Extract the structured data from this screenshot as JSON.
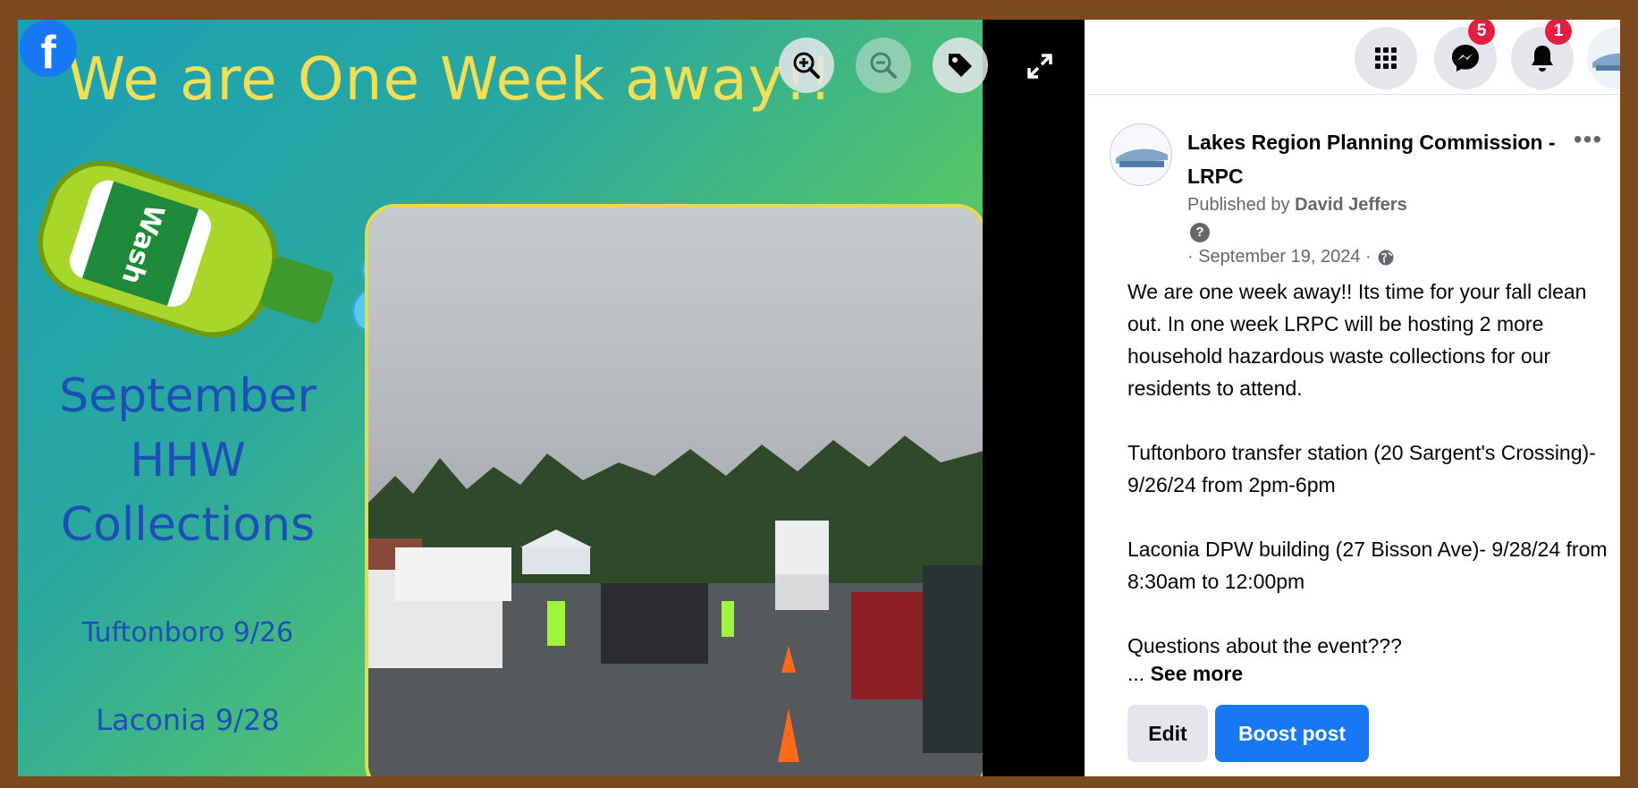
{
  "poster": {
    "title": "We are One Week away!!",
    "bottle_label": "Wash",
    "heading_lines": [
      "September",
      "HHW",
      "Collections"
    ],
    "event1": "Tuftonboro 9/26",
    "event2": "Laconia 9/28"
  },
  "viewer": {
    "brand_icon": "facebook-icon",
    "controls": [
      "zoom-in-icon",
      "zoom-out-icon",
      "tag-icon",
      "expand-icon"
    ]
  },
  "topbar": {
    "menu_icon": "grid-menu-icon",
    "messenger_badge": "5",
    "notifications_badge": "1"
  },
  "post": {
    "page_name": "Lakes Region Planning Commission - LRPC",
    "published_prefix": "Published by",
    "published_by": "David Jeffers",
    "date": "· September 19, 2024 ·",
    "more_label": "•••",
    "body": [
      "We are one week away!! Its time for your fall clean out. In one week LRPC will be hosting 2 more household hazardous waste collections for our residents to attend.",
      "Tuftonboro transfer station (20 Sargent's Crossing)- 9/26/24 from 2pm-6pm",
      "Laconia DPW building (27 Bisson Ave)- 9/28/24 from 8:30am to 12:00pm",
      "Questions about the event???"
    ],
    "see_more_prefix": "...",
    "see_more": "See more",
    "edit_label": "Edit",
    "boost_label": "Boost post"
  },
  "colors": {
    "frame": "#7a4a1e",
    "facebook_blue": "#1877f2",
    "badge_red": "#e41e3f",
    "poster_title": "#f2df55",
    "poster_text": "#1e4fb8"
  }
}
